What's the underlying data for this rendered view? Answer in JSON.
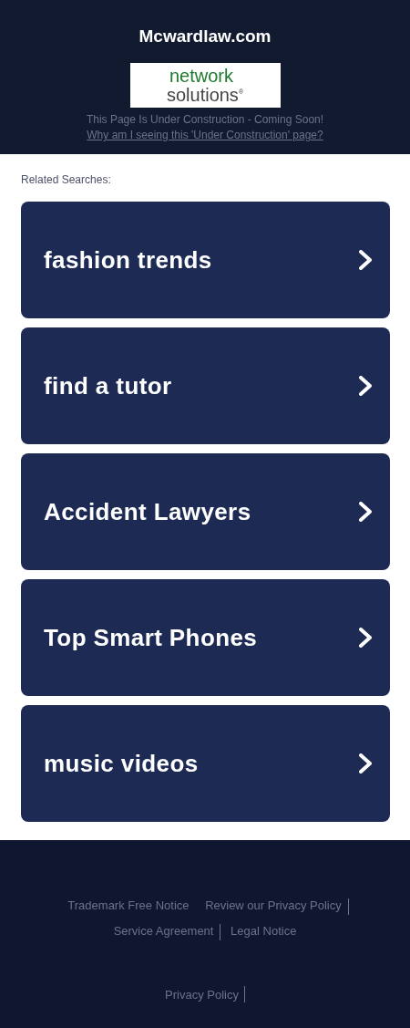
{
  "header": {
    "domain": "Mcwardlaw.com",
    "logo": {
      "line_1": "network",
      "line_2": "solutions",
      "mark": "®"
    },
    "notice": "This Page Is Under Construction - Coming Soon!",
    "why_link": "Why am I seeing this 'Under Construction' page?"
  },
  "related": {
    "label": "Related Searches:",
    "items": [
      {
        "label": "fashion trends"
      },
      {
        "label": "find a tutor"
      },
      {
        "label": "Accident Lawyers"
      },
      {
        "label": "Top Smart Phones"
      },
      {
        "label": "music videos"
      }
    ]
  },
  "footer": {
    "links": [
      {
        "label": "Trademark Free Notice",
        "divider_before": false
      },
      {
        "label": "Review our Privacy Policy",
        "divider_before": false
      },
      {
        "label": "Service Agreement",
        "divider_before": true
      },
      {
        "label": "Legal Notice",
        "divider_before": true
      }
    ],
    "bottom_links": [
      {
        "label": "Privacy Policy",
        "divider_after": true
      }
    ]
  }
}
